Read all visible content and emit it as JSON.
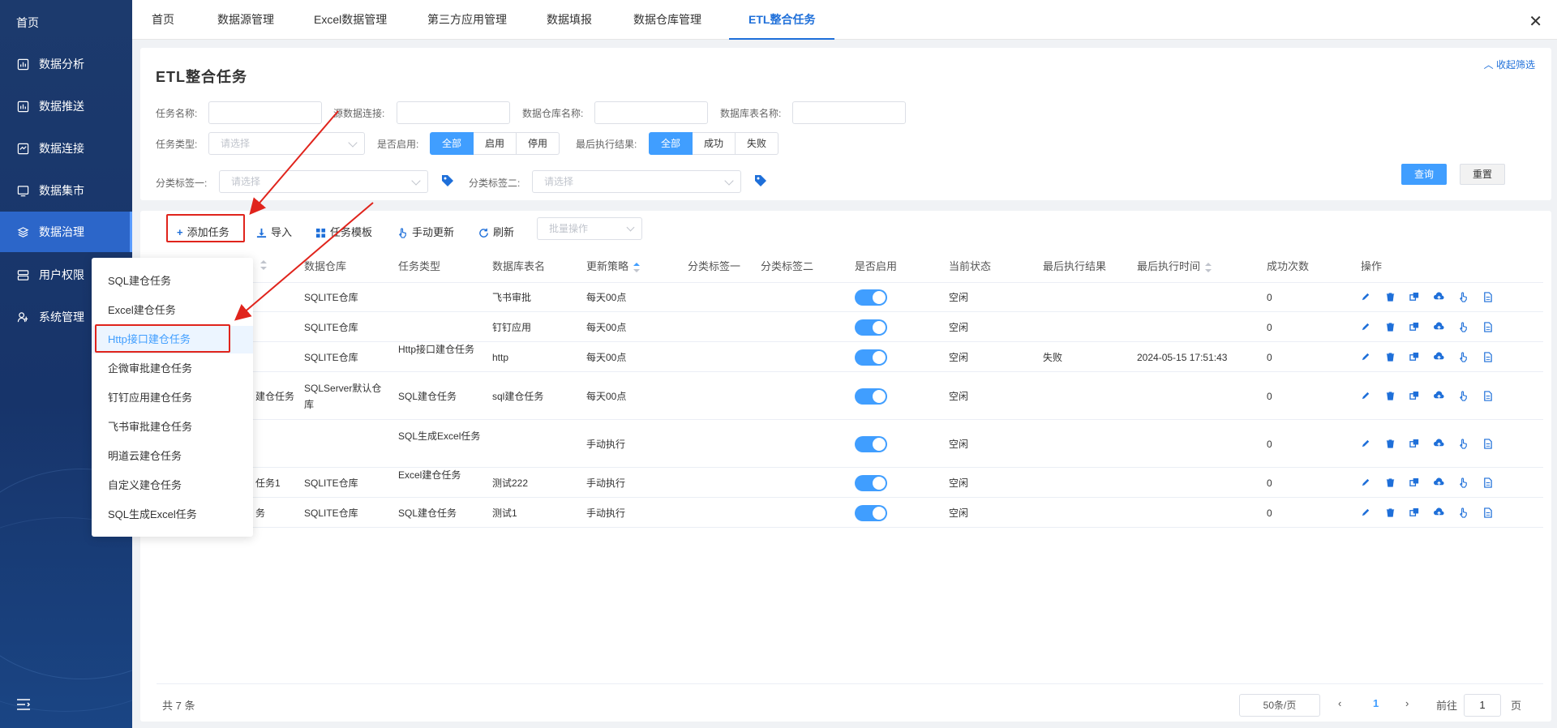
{
  "sidebar": {
    "home": "首页",
    "items": [
      {
        "label": "数据分析",
        "icon": "chart-icon"
      },
      {
        "label": "数据推送",
        "icon": "push-icon"
      },
      {
        "label": "数据连接",
        "icon": "connect-icon"
      },
      {
        "label": "数据集市",
        "icon": "monitor-icon"
      },
      {
        "label": "数据治理",
        "icon": "layers-icon"
      },
      {
        "label": "用户权限",
        "icon": "user-perm-icon"
      },
      {
        "label": "系统管理",
        "icon": "system-icon"
      }
    ]
  },
  "tabs": [
    "首页",
    "数据源管理",
    "Excel数据管理",
    "第三方应用管理",
    "数据填报",
    "数据仓库管理",
    "ETL整合任务"
  ],
  "page_title": "ETL整合任务",
  "collapse_label": "收起筛选",
  "filters": {
    "task_name": "任务名称:",
    "source_conn": "源数据连接:",
    "warehouse_name": "数据仓库名称:",
    "db_table_name": "数据库表名称:",
    "task_type": "任务类型:",
    "task_type_placeholder": "请选择",
    "enabled_label": "是否启用:",
    "enabled_options": [
      "全部",
      "启用",
      "停用"
    ],
    "last_result_label": "最后执行结果:",
    "last_result_options": [
      "全部",
      "成功",
      "失败"
    ],
    "tag1_label": "分类标签一:",
    "tag1_placeholder": "请选择",
    "tag2_label": "分类标签二:",
    "tag2_placeholder": "请选择",
    "query": "查询",
    "reset": "重置"
  },
  "toolbar": {
    "add": "添加任务",
    "import": "导入",
    "template": "任务模板",
    "manual": "手动更新",
    "refresh": "刷新",
    "batch_placeholder": "批量操作"
  },
  "columns": [
    "数据仓库",
    "任务类型",
    "数据库表名",
    "更新策略",
    "分类标签一",
    "分类标签二",
    "是否启用",
    "当前状态",
    "最后执行结果",
    "最后执行时间",
    "成功次数",
    "操作"
  ],
  "rows": [
    {
      "name": "",
      "warehouse": "SQLITE仓库",
      "type": "",
      "table": "飞书审批",
      "strategy": "每天00点",
      "status": "空闲",
      "result": "",
      "time": "",
      "count": "0"
    },
    {
      "name": "",
      "warehouse": "SQLITE仓库",
      "type": "",
      "table": "钉钉应用",
      "strategy": "每天00点",
      "status": "空闲",
      "result": "",
      "time": "",
      "count": "0"
    },
    {
      "name": "",
      "warehouse": "SQLITE仓库",
      "type": "Http接口建仓任务",
      "table": "http",
      "strategy": "每天00点",
      "status": "空闲",
      "result": "失败",
      "time": "2024-05-15 17:51:43",
      "count": "0"
    },
    {
      "name": "建仓任务",
      "warehouse": "SQLServer默认仓库",
      "type": "SQL建仓任务",
      "table": "sql建仓任务",
      "strategy": "每天00点",
      "status": "空闲",
      "result": "",
      "time": "",
      "count": "0"
    },
    {
      "name": "",
      "warehouse": "",
      "type": "SQL生成Excel任务",
      "table": "",
      "strategy": "手动执行",
      "status": "空闲",
      "result": "",
      "time": "",
      "count": "0"
    },
    {
      "name": "任务1",
      "warehouse": "SQLITE仓库",
      "type": "Excel建仓任务",
      "table": "测试222",
      "strategy": "手动执行",
      "status": "空闲",
      "result": "",
      "time": "",
      "count": "0"
    },
    {
      "name": "务",
      "warehouse": "SQLITE仓库",
      "type": "SQL建仓任务",
      "table": "测试1",
      "strategy": "手动执行",
      "status": "空闲",
      "result": "",
      "time": "",
      "count": "0"
    }
  ],
  "footer": {
    "total": "共 7 条",
    "page_size": "50条/页",
    "current_page": "1",
    "goto_prefix": "前往",
    "goto_value": "1",
    "goto_suffix": "页"
  },
  "dropdown": [
    "SQL建仓任务",
    "Excel建仓任务",
    "Http接口建仓任务",
    "企微审批建仓任务",
    "钉钉应用建仓任务",
    "飞书审批建仓任务",
    "明道云建仓任务",
    "自定义建仓任务",
    "SQL生成Excel任务"
  ],
  "colors": {
    "accent": "#409eff",
    "sidebar": "#1c3a6d",
    "annotation": "#e0241c"
  }
}
